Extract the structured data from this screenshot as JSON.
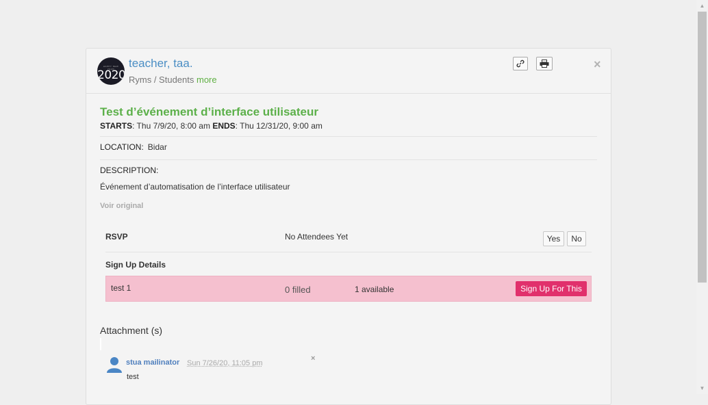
{
  "header": {
    "avatar_year": "2020",
    "avatar_tagline": "HAPPY NEW YEAR",
    "title": "teacher, taa.",
    "sub_path": "Ryms / Students",
    "sub_more": "more",
    "close": "×"
  },
  "event": {
    "title": "Test d’événement d’interface utilisateur",
    "starts_label": "STARTS",
    "starts_value": ": Thu 7/9/20, 8:00 am",
    "ends_label": "ENDS",
    "ends_value": ": Thu 12/31/20, 9:00 am",
    "location_label": "LOCATION:",
    "location_value": "Bidar",
    "description_label": "DESCRIPTION:",
    "description_text": "Événement d’automatisation de l’interface utilisateur",
    "voir_original": "Voir original"
  },
  "rsvp": {
    "label": "RSVP",
    "status": "No Attendees Yet",
    "yes": "Yes",
    "no": "No"
  },
  "signup": {
    "label": "Sign Up Details",
    "rows": [
      {
        "name": "test 1",
        "filled": "0 filled",
        "available": "1 available",
        "button": "Sign Up For This"
      }
    ]
  },
  "attachments": {
    "title": "Attachment (s)"
  },
  "comment": {
    "author": "stua mailinator",
    "time": "Sun 7/26/20, 11:05 pm",
    "close": "×",
    "text": "test"
  },
  "colors": {
    "accent_green": "#5cb04a",
    "link_blue": "#4b8ec4",
    "signup_row_bg": "#f5c0cf",
    "signup_button": "#e1306c"
  },
  "icons": [
    "link-icon",
    "print-icon",
    "close-icon",
    "user-icon"
  ]
}
